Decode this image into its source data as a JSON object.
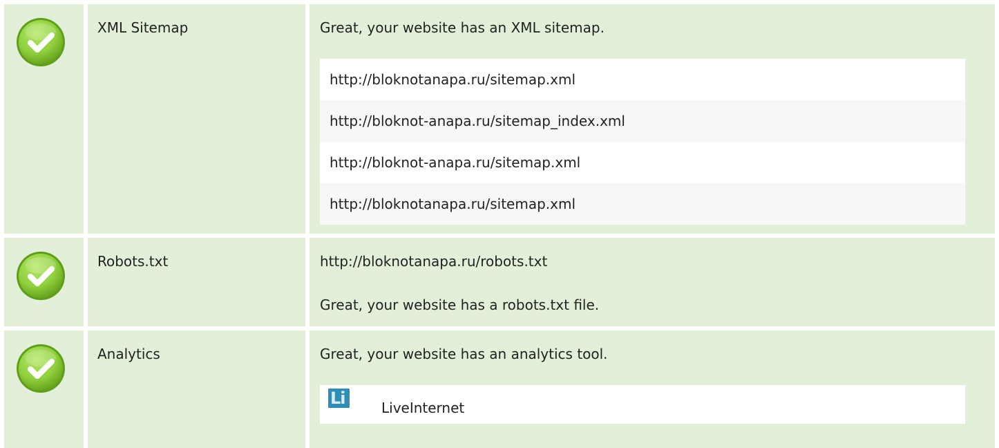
{
  "checks": [
    {
      "name": "XML Sitemap",
      "status": "passed",
      "message": "Great, your website has an XML sitemap.",
      "sitemaps": [
        "http://bloknotanapa.ru/sitemap.xml",
        "http://bloknot-anapa.ru/sitemap_index.xml",
        "http://bloknot-anapa.ru/sitemap.xml",
        "http://bloknotanapa.ru/sitemap.xml"
      ]
    },
    {
      "name": "Robots.txt",
      "status": "passed",
      "url": "http://bloknotanapa.ru/robots.txt",
      "message": "Great, your website has a robots.txt file."
    },
    {
      "name": "Analytics",
      "status": "passed",
      "message": "Great, your website has an analytics tool.",
      "tools": [
        {
          "logo_text": "Li",
          "name": "LiveInternet",
          "icon": "liveinternet-logo-icon"
        }
      ]
    }
  ],
  "colors": {
    "row_background": "#e2f0d9",
    "check_green": "#8ecf3c",
    "check_green_dark": "#5f9e18",
    "liveinternet_blue": "#2d8fb4"
  },
  "icons": {
    "status": "check-circle-icon"
  }
}
